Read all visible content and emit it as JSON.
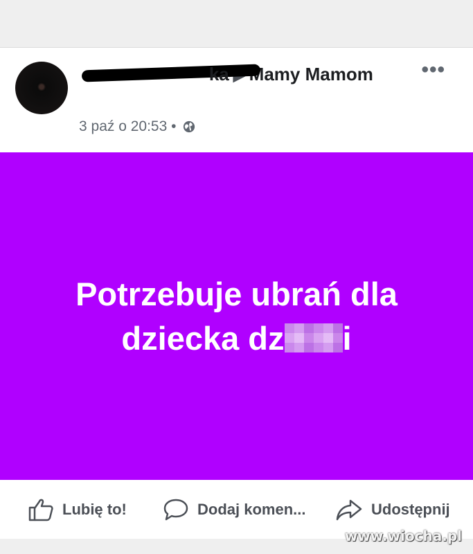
{
  "post": {
    "author_visible_end": "ka",
    "group": "Mamy Mamom",
    "timestamp": "3 paź o 20:53",
    "separator": "•",
    "more_label": "•••"
  },
  "banner": {
    "color": "#b000ff",
    "line1": "Potrzebuje ubrań dla",
    "line2_start": "dziecka dz",
    "line2_end": "i"
  },
  "actions": {
    "like": "Lubię to!",
    "comment": "Dodaj komen...",
    "share": "Udostępnij"
  },
  "watermark": "www.wiocha.pl"
}
